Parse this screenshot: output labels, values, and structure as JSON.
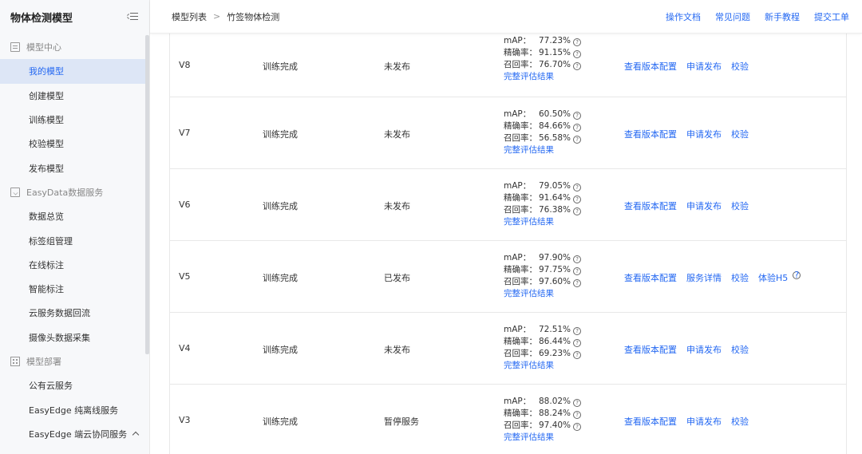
{
  "sidebar": {
    "title": "物体检测模型",
    "groups": [
      {
        "label": "模型中心",
        "icon": "model-center-icon",
        "items": [
          "我的模型",
          "创建模型",
          "训练模型",
          "校验模型",
          "发布模型"
        ]
      },
      {
        "label": "EasyData数据服务",
        "icon": "data-service-icon",
        "items": [
          "数据总览",
          "标签组管理",
          "在线标注",
          "智能标注",
          "云服务数据回流",
          "摄像头数据采集"
        ]
      },
      {
        "label": "模型部署",
        "icon": "deploy-icon",
        "items": [
          "公有云服务",
          "EasyEdge 纯离线服务",
          "EasyEdge 端云协同服务"
        ]
      }
    ],
    "active_item": "我的模型"
  },
  "breadcrumb": {
    "root": "模型列表",
    "sep": ">",
    "current": "竹签物体检测"
  },
  "top_links": [
    "操作文档",
    "常见问题",
    "新手教程",
    "提交工单"
  ],
  "metric_labels": {
    "map": "mAP：",
    "precision": "精确率：",
    "recall": "召回率：",
    "full": "完整评估结果"
  },
  "help_glyph": "?",
  "rows": [
    {
      "version": "V8",
      "status": "训练完成",
      "publish": "未发布",
      "map": "77.23%",
      "precision": "91.15%",
      "recall": "76.70%",
      "ops": [
        "查看版本配置",
        "申请发布",
        "校验"
      ]
    },
    {
      "version": "V7",
      "status": "训练完成",
      "publish": "未发布",
      "map": "60.50%",
      "precision": "84.66%",
      "recall": "56.58%",
      "ops": [
        "查看版本配置",
        "申请发布",
        "校验"
      ]
    },
    {
      "version": "V6",
      "status": "训练完成",
      "publish": "未发布",
      "map": "79.05%",
      "precision": "91.64%",
      "recall": "76.38%",
      "ops": [
        "查看版本配置",
        "申请发布",
        "校验"
      ]
    },
    {
      "version": "V5",
      "status": "训练完成",
      "publish": "已发布",
      "map": "97.90%",
      "precision": "97.75%",
      "recall": "97.60%",
      "ops": [
        "查看版本配置",
        "服务详情",
        "校验",
        "体验H5"
      ]
    },
    {
      "version": "V4",
      "status": "训练完成",
      "publish": "未发布",
      "map": "72.51%",
      "precision": "86.44%",
      "recall": "69.23%",
      "ops": [
        "查看版本配置",
        "申请发布",
        "校验"
      ]
    },
    {
      "version": "V3",
      "status": "训练完成",
      "publish": "暂停服务",
      "map": "88.02%",
      "precision": "88.24%",
      "recall": "97.40%",
      "ops": [
        "查看版本配置",
        "申请发布",
        "校验"
      ]
    }
  ]
}
